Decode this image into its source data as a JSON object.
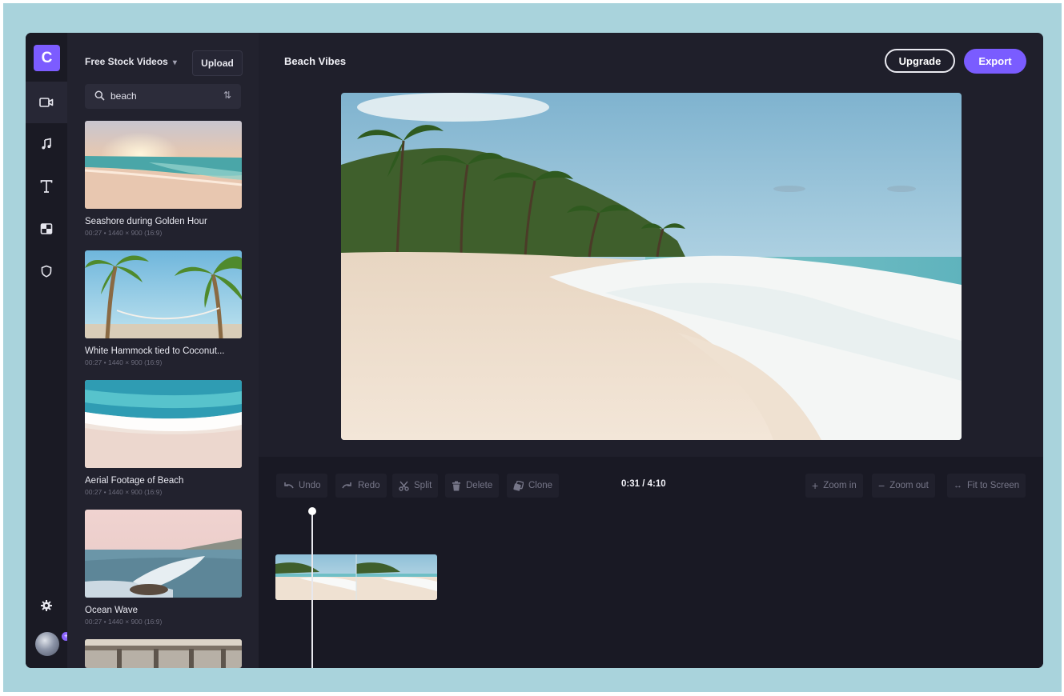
{
  "app": {
    "logo_letter": "C"
  },
  "rail": {
    "items": [
      {
        "name": "video-icon",
        "label": "Video"
      },
      {
        "name": "music-icon",
        "label": "Music"
      },
      {
        "name": "text-icon",
        "label": "Text"
      },
      {
        "name": "transitions-icon",
        "label": "Transitions"
      },
      {
        "name": "brand-kit-icon",
        "label": "Brand"
      }
    ]
  },
  "media": {
    "source_label": "Free Stock Videos",
    "upload_label": "Upload",
    "search": {
      "value": "beach"
    },
    "items": [
      {
        "title": "Seashore during Golden Hour",
        "meta": "00:27 • 1440 × 900 (16:9)"
      },
      {
        "title": "White Hammock tied to Coconut...",
        "meta": "00:27 • 1440 × 900 (16:9)"
      },
      {
        "title": "Aerial Footage of Beach",
        "meta": "00:27 • 1440 × 900 (16:9)"
      },
      {
        "title": "Ocean Wave",
        "meta": "00:27 • 1440 × 900 (16:9)"
      }
    ]
  },
  "header": {
    "project_title": "Beach Vibes",
    "upgrade_label": "Upgrade",
    "export_label": "Export"
  },
  "timeline": {
    "undo": "Undo",
    "redo": "Redo",
    "split": "Split",
    "delete": "Delete",
    "clone": "Clone",
    "time": "0:31 / 4:10",
    "zoom_in": "Zoom in",
    "zoom_out": "Zoom out",
    "fit": "Fit to Screen"
  },
  "colors": {
    "accent": "#7a5cff",
    "background": "#1f1f2b",
    "frame": "#a9d3dc"
  }
}
